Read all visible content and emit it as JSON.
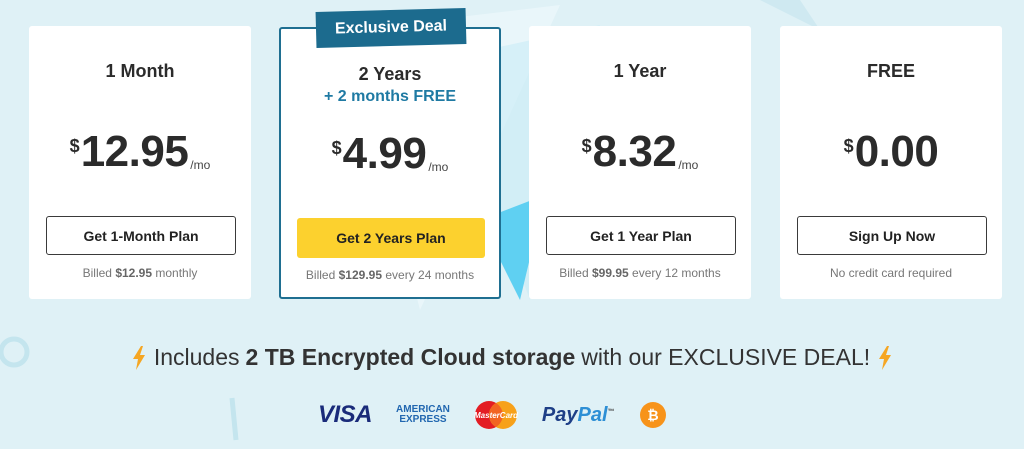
{
  "ribbon": {
    "label": "Exclusive Deal"
  },
  "plans": [
    {
      "name": "1 Month",
      "currency": "$",
      "amount": "12.95",
      "per": "/mo",
      "button": "Get 1-Month Plan",
      "billed_prefix": "Billed",
      "billed_amount": "$12.95",
      "billed_suffix": "monthly"
    },
    {
      "name": "2 Years",
      "subtitle": "+ 2 months FREE",
      "currency": "$",
      "amount": "4.99",
      "per": "/mo",
      "button": "Get 2 Years Plan",
      "billed_prefix": "Billed",
      "billed_amount": "$129.95",
      "billed_suffix": "every 24 months"
    },
    {
      "name": "1 Year",
      "currency": "$",
      "amount": "8.32",
      "per": "/mo",
      "button": "Get 1 Year Plan",
      "billed_prefix": "Billed",
      "billed_amount": "$99.95",
      "billed_suffix": "every 12 months"
    },
    {
      "name": "FREE",
      "currency": "$",
      "amount": "0.00",
      "button": "Sign Up Now",
      "note": "No credit card required"
    }
  ],
  "promo": {
    "prefix": "Includes",
    "highlight": "2 TB Encrypted Cloud storage",
    "suffix": "with our EXCLUSIVE DEAL!",
    "icon": "lightning-bolt-icon"
  },
  "payments": {
    "visa": "VISA",
    "amex_top": "AMERICAN",
    "amex_bottom": "EXPRESS",
    "mastercard": "MasterCard",
    "paypal_pay": "Pay",
    "paypal_pal": "Pal",
    "paypal_tm": "™",
    "bitcoin": "₿"
  },
  "colors": {
    "background": "#dff1f6",
    "ribbon": "#1c6b8e",
    "featured_border": "#1f6f91",
    "accent_text": "#1f7aa3",
    "primary_button": "#fcd12e",
    "bolt": "#f5a623"
  }
}
